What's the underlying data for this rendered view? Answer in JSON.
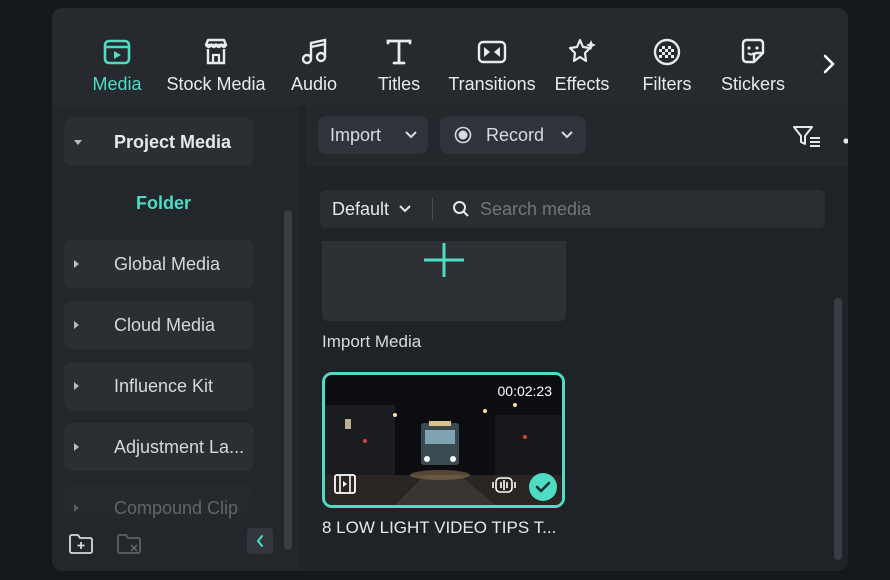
{
  "tabs": [
    {
      "label": "Media",
      "icon": "media-icon",
      "active": true
    },
    {
      "label": "Stock Media",
      "icon": "stock-media-icon"
    },
    {
      "label": "Audio",
      "icon": "audio-icon"
    },
    {
      "label": "Titles",
      "icon": "titles-icon"
    },
    {
      "label": "Transitions",
      "icon": "transitions-icon"
    },
    {
      "label": "Effects",
      "icon": "effects-icon"
    },
    {
      "label": "Filters",
      "icon": "filters-icon"
    },
    {
      "label": "Stickers",
      "icon": "stickers-icon"
    }
  ],
  "sidebar": {
    "project_media": "Project Media",
    "folder": "Folder",
    "items": [
      "Global Media",
      "Cloud Media",
      "Influence Kit",
      "Adjustment La...",
      "Compound Clip"
    ]
  },
  "toolbar": {
    "import_label": "Import",
    "record_label": "Record"
  },
  "search": {
    "sort_label": "Default",
    "placeholder": "Search media"
  },
  "media": {
    "import_label": "Import Media",
    "clip": {
      "duration": "00:02:23",
      "title": "8 LOW LIGHT VIDEO TIPS T..."
    }
  },
  "colors": {
    "accent": "#4fdcc4",
    "background": "#202328",
    "panel": "#2b2e33"
  }
}
